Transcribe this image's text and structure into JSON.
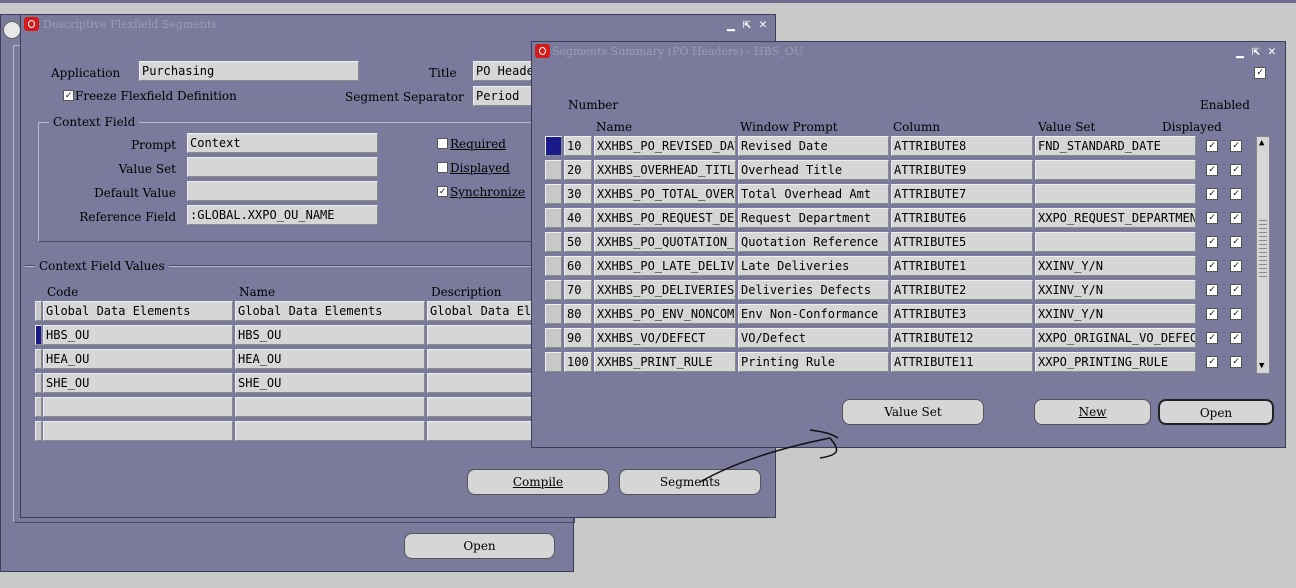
{
  "win1": {
    "title": "Descriptive Flexfield Segments",
    "application_label": "Application",
    "application_value": "Purchasing",
    "title_label": "Title",
    "title_value": "PO Heade",
    "freeze_label": "Freeze Flexfield Definition",
    "freeze_checked": true,
    "separator_label": "Segment Separator",
    "separator_value": "Period",
    "context_field": {
      "group_title": "Context Field",
      "prompt_label": "Prompt",
      "prompt_value": "Context",
      "valueset_label": "Value Set",
      "default_label": "Default Value",
      "reference_label": "Reference Field",
      "reference_value": ":GLOBAL.XXPO_OU_NAME",
      "required_label": "Required",
      "displayed_label": "Displayed",
      "synchronize_label": "Synchronize"
    },
    "context_values": {
      "group_title": "Context Field Values",
      "headers": [
        "Code",
        "Name",
        "Description"
      ],
      "rows": [
        [
          "Global Data Elements",
          "Global Data Elements",
          "Global Data Ele"
        ],
        [
          "HBS_OU",
          "HBS_OU",
          ""
        ],
        [
          "HEA_OU",
          "HEA_OU",
          ""
        ],
        [
          "SHE_OU",
          "SHE_OU",
          ""
        ],
        [
          "",
          "",
          ""
        ],
        [
          "",
          "",
          ""
        ]
      ]
    },
    "compile_label": "Compile",
    "segments_label": "Segments",
    "open_label": "Open"
  },
  "win2": {
    "title": "Segments Summary (PO Headers) - HBS_OU",
    "headers": {
      "number": "Number",
      "name": "Name",
      "prompt": "Window Prompt",
      "column": "Column",
      "valueset": "Value Set",
      "displayed": "Displayed",
      "enabled": "Enabled"
    },
    "rows": [
      {
        "number": "10",
        "name": "XXHBS_PO_REVISED_DAT",
        "prompt": "Revised Date",
        "column": "ATTRIBUTE8",
        "valueset": "FND_STANDARD_DATE"
      },
      {
        "number": "20",
        "name": "XXHBS_OVERHEAD_TITLE",
        "prompt": "Overhead Title",
        "column": "ATTRIBUTE9",
        "valueset": ""
      },
      {
        "number": "30",
        "name": "XXHBS_PO_TOTAL_OVERH",
        "prompt": "Total Overhead Amt",
        "column": "ATTRIBUTE7",
        "valueset": ""
      },
      {
        "number": "40",
        "name": "XXHBS_PO_REQUEST_DEP",
        "prompt": "Request Department",
        "column": "ATTRIBUTE6",
        "valueset": "XXPO_REQUEST_DEPARTMENT"
      },
      {
        "number": "50",
        "name": "XXHBS_PO_QUOTATION_R",
        "prompt": "Quotation Reference",
        "column": "ATTRIBUTE5",
        "valueset": ""
      },
      {
        "number": "60",
        "name": "XXHBS_PO_LATE_DELIVE",
        "prompt": "Late Deliveries",
        "column": "ATTRIBUTE1",
        "valueset": "XXINV_Y/N"
      },
      {
        "number": "70",
        "name": "XXHBS_PO_DELIVERIES_",
        "prompt": "Deliveries Defects",
        "column": "ATTRIBUTE2",
        "valueset": "XXINV_Y/N"
      },
      {
        "number": "80",
        "name": "XXHBS_PO_ENV_NONCOMF",
        "prompt": "Env Non-Conformance",
        "column": "ATTRIBUTE3",
        "valueset": "XXINV_Y/N"
      },
      {
        "number": "90",
        "name": "XXHBS_VO/DEFECT",
        "prompt": "VO/Defect",
        "column": "ATTRIBUTE12",
        "valueset": "XXPO_ORIGINAL_VO_DEFECT"
      },
      {
        "number": "100",
        "name": "XXHBS_PRINT_RULE",
        "prompt": "Printing Rule",
        "column": "ATTRIBUTE11",
        "valueset": "XXPO_PRINTING_RULE"
      }
    ],
    "check_mark": "✓",
    "value_set_label": "Value Set",
    "new_label": "New",
    "open_label": "Open"
  },
  "colors": {
    "window_bg": "#7a7a9c",
    "field_bg": "#d6d6d6",
    "current_record": "#1a1a8a",
    "oracle_red": "#d41a1a"
  }
}
